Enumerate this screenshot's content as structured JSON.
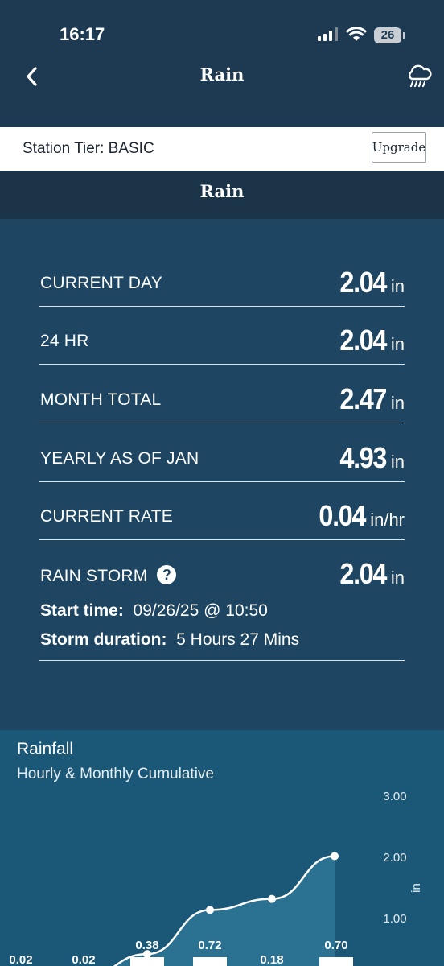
{
  "status_bar": {
    "time": "16:17",
    "battery": "26"
  },
  "nav": {
    "title": "Rain",
    "back_icon": "chevron-left-icon",
    "right_icon": "rain-cloud-icon"
  },
  "tier": {
    "label": "Station Tier: BASIC",
    "upgrade": "Upgrade"
  },
  "section": {
    "title": "Rain"
  },
  "rain": {
    "rows": [
      {
        "label": "CURRENT DAY",
        "value": "2.04",
        "unit": "in"
      },
      {
        "label": "24 HR",
        "value": "2.04",
        "unit": "in"
      },
      {
        "label": "MONTH TOTAL",
        "value": "2.47",
        "unit": "in"
      },
      {
        "label": "YEARLY AS OF JAN",
        "value": "4.93",
        "unit": "in"
      },
      {
        "label": "CURRENT RATE",
        "value": "0.04",
        "unit": "in/hr"
      },
      {
        "label": "RAIN STORM",
        "value": "2.04",
        "unit": "in"
      }
    ],
    "help_glyph": "?",
    "start_label": "Start time:",
    "start_value": "09/26/25 @ 10:50",
    "duration_label": "Storm duration:",
    "duration_value": "5 Hours 27 Mins"
  },
  "chart_title": "Rainfall",
  "chart_subtitle": "Hourly & Monthly Cumulative",
  "chart_data": {
    "type": "bar",
    "title": "Rainfall",
    "subtitle": "Hourly & Monthly Cumulative",
    "ylabel": "in",
    "ylim": [
      0,
      3
    ],
    "y_ticks": [
      "1.00",
      "2.00",
      "3.00"
    ],
    "series": [
      {
        "kind": "bar",
        "values": [
          0.02,
          0.02,
          0.38,
          0.72,
          0.18,
          0.7
        ]
      },
      {
        "kind": "area-line",
        "values": [
          0.02,
          0.04,
          0.42,
          1.14,
          1.32,
          2.02
        ]
      }
    ],
    "bar_labels": [
      "0.02",
      "0.02",
      "0.38",
      "0.72",
      "0.18",
      "0.70"
    ],
    "colors": {
      "bar": "#ffffff",
      "line": "#ffffff",
      "area": "#2e7596"
    }
  }
}
